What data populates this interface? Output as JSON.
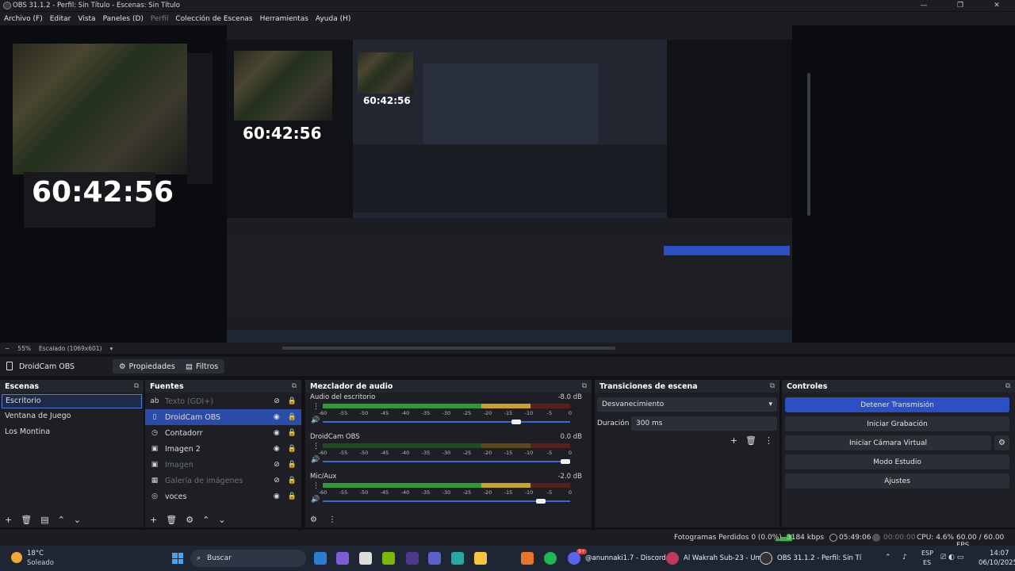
{
  "window": {
    "title": "OBS 31.1.2 - Perfil: Sin Título - Escenas: Sin Título",
    "minimize": "—",
    "maximize": "❐",
    "close": "✕"
  },
  "menu": [
    "Archivo (F)",
    "Editar",
    "Vista",
    "Paneles (D)",
    "Perfil",
    "Colección de Escenas",
    "Herramientas",
    "Ayuda (H)"
  ],
  "preview": {
    "clock": "60:42:56"
  },
  "zoom": {
    "minus": "−",
    "level": "55%",
    "scaled": "Escalado (1069x601)"
  },
  "source_toolbar": {
    "current_source": "DroidCam OBS",
    "properties": "Propiedades",
    "filters": "Filtros"
  },
  "scenes": {
    "title": "Escenas",
    "items": [
      "Escritorio",
      "Ventana de Juego",
      "Los Montina"
    ],
    "selected": "Escritorio"
  },
  "sources": {
    "title": "Fuentes",
    "items": [
      {
        "name": "Texto (GDI+)",
        "icon": "text-icon",
        "hidden": true
      },
      {
        "name": "DroidCam OBS",
        "icon": "camera-icon",
        "hidden": false,
        "selected": true
      },
      {
        "name": "Contadorr",
        "icon": "clock-icon",
        "hidden": false
      },
      {
        "name": "Imagen 2",
        "icon": "image-icon",
        "hidden": false
      },
      {
        "name": "Imagen",
        "icon": "image-icon",
        "hidden": true
      },
      {
        "name": "Galería de imágenes",
        "icon": "gallery-icon",
        "hidden": true
      },
      {
        "name": "voces",
        "icon": "audio-icon",
        "hidden": false
      }
    ]
  },
  "mixer": {
    "title": "Mezclador de audio",
    "ticks": [
      "-60",
      "-55",
      "-50",
      "-45",
      "-40",
      "-35",
      "-30",
      "-25",
      "-20",
      "-15",
      "-10",
      "-5",
      "0"
    ],
    "channels": [
      {
        "name": "Audio del escritorio",
        "db": "-8.0 dB",
        "level": 0.84,
        "volume": 0.8
      },
      {
        "name": "DroidCam OBS",
        "db": "0.0 dB",
        "level": 0.0,
        "volume": 1.0
      },
      {
        "name": "Mic/Aux",
        "db": "-2.0 dB",
        "level": 0.86,
        "volume": 0.9
      }
    ]
  },
  "transitions": {
    "title": "Transiciones de escena",
    "selected": "Desvanecimiento",
    "duration_label": "Duración",
    "duration": "300 ms"
  },
  "controls": {
    "title": "Controles",
    "buttons": [
      "Detener Transmisión",
      "Iniciar Grabación",
      "Iniciar Cámara Virtual",
      "Modo Estudio",
      "Ajustes"
    ]
  },
  "status": {
    "dropped": "Fotogramas Perdidos 0 (0.0%)",
    "kbps": "3184 kbps",
    "stream_time": "05:49:06",
    "rec_time": "00:00:00",
    "cpu": "CPU: 4.6%",
    "fps": "60.00 / 60.00 FPS"
  },
  "taskbar": {
    "temp": "18°C",
    "weather": "Soleado",
    "search": "Buscar",
    "apps": [
      "@anunnaki1.7 - Discord",
      "Al Wakrah Sub-23 - Um",
      "OBS 31.1.2 - Perfil: Sin Tí"
    ],
    "lang": "ESP",
    "region": "ES",
    "time": "14:07",
    "date": "06/10/2025",
    "discord_badge": "9+"
  },
  "colors": {
    "accent": "#2c50c4",
    "selected": "#2b4ba8",
    "meter_green": "#2e9a37",
    "meter_yellow": "#c8a22b",
    "meter_red": "#b83232"
  }
}
